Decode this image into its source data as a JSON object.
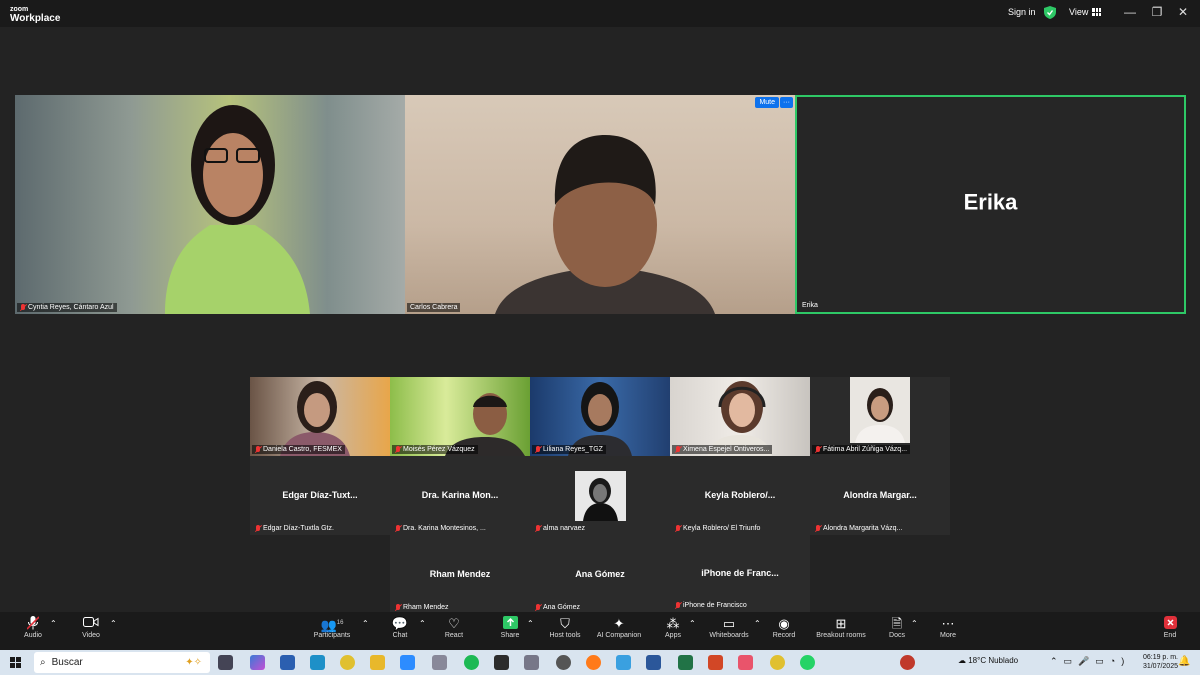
{
  "app": {
    "logo_line1": "zoom",
    "logo_line2": "Workplace",
    "signin": "Sign in",
    "view": "View"
  },
  "speakers": [
    {
      "name": "Cyntia Reyes, Cántaro Azul"
    },
    {
      "name": "Carlos Cabrera",
      "mute_label": "Mute",
      "more_label": "···"
    },
    {
      "name": "Erika",
      "display_name": "Erika"
    }
  ],
  "gallery_row1": [
    {
      "name": "Daniela Castro, FESMEX"
    },
    {
      "name": "Moisés Pérez Vázquez"
    },
    {
      "name": "Liliana Reyes_TGZ"
    },
    {
      "name": "Ximena Espejel Ontiveros..."
    },
    {
      "name": "Fátima Abril Zúñiga Vázq..."
    }
  ],
  "gallery_row2": [
    {
      "display": "Edgar  Díaz-Tuxt...",
      "name": "Edgar Díaz-Tuxtla Gtz."
    },
    {
      "display": "Dra.  Karina  Mon...",
      "name": "Dra. Karina Montesinos, ..."
    },
    {
      "display": "",
      "name": "alma narvaez"
    },
    {
      "display": "Keyla  Roblero/...",
      "name": "Keyla Roblero/ El Triunfo"
    },
    {
      "display": "Alondra  Margar...",
      "name": "Alondra Margarita Vázq..."
    }
  ],
  "gallery_row3": [
    {
      "display": "Rham  Mendez",
      "name": "Rham Mendez"
    },
    {
      "display": "Ana  Gómez",
      "name": "Ana Gómez"
    },
    {
      "display": "iPhone  de  Franc...",
      "name": "iPhone de Francisco"
    }
  ],
  "toolbar": {
    "audio": "Audio",
    "video": "Video",
    "participants": "Participants",
    "participants_count": "16",
    "chat": "Chat",
    "react": "React",
    "share": "Share",
    "host_tools": "Host tools",
    "ai_companion": "AI Companion",
    "apps": "Apps",
    "whiteboards": "Whiteboards",
    "record": "Record",
    "breakout": "Breakout rooms",
    "docs": "Docs",
    "more": "More",
    "end": "End"
  },
  "taskbar": {
    "search": "Buscar",
    "weather": "18°C  Nublado",
    "time": "06:19 p. m.",
    "date": "31/07/2025"
  },
  "colors": {
    "active_speaker_border": "#2ec866",
    "end_red": "#e0303a",
    "share_green": "#2ec866"
  }
}
